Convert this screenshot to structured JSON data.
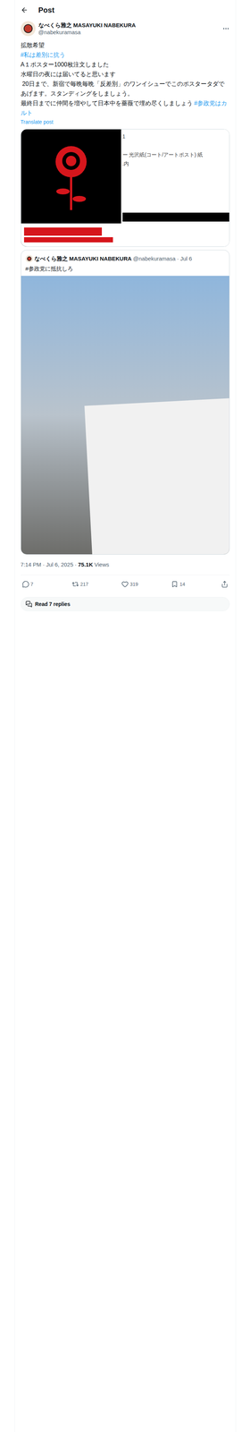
{
  "header": {
    "title": "Post"
  },
  "author": {
    "name": "なべくら雅之 MASAYUKI NABEKURA",
    "handle": "@nabekuramasa"
  },
  "post": {
    "paragraphs": [
      [
        {
          "text": "拡散希望",
          "link": false
        }
      ],
      [
        {
          "text": "#私は差別に抗う",
          "link": true
        }
      ],
      [
        {
          "text": "A１ポスター1000枚注文しました",
          "link": false
        }
      ],
      [
        {
          "text": "水曜日の夜には届いてると思います",
          "link": false
        }
      ],
      [
        {
          "text": " 20日まで、新宿で毎晩毎晩「反差別」のワンイシューでこのポスタータダであげます。スタンディングをしましょう。",
          "link": false
        }
      ],
      [
        {
          "text": "最終日までに仲間を増やして日本中を薔薇で埋め尽くしましょう ",
          "link": false
        },
        {
          "text": "#参政党はカルト",
          "link": true
        }
      ]
    ],
    "translate": "Translate post"
  },
  "media_card": {
    "order_lines": [
      "1",
      "ー 光沢紙(コート/アートポスト) 紙",
      ".内"
    ]
  },
  "quote": {
    "name": "なべくら雅之 MASAYUKI NABEKURA",
    "handle": "@nabekuramasa",
    "separator": "·",
    "date": "Jul 6",
    "text": "#参政党に抵抗しろ"
  },
  "meta": {
    "time": "7:14 PM",
    "separator": "·",
    "date": "Jul 6, 2025",
    "views": "75.1K",
    "views_label": "Views"
  },
  "actions": [
    {
      "kind": "reply",
      "count": "7"
    },
    {
      "kind": "repost",
      "count": "217"
    },
    {
      "kind": "like",
      "count": "319"
    },
    {
      "kind": "bookmark",
      "count": "14"
    },
    {
      "kind": "share",
      "count": ""
    }
  ],
  "read_replies": "Read 7 replies"
}
